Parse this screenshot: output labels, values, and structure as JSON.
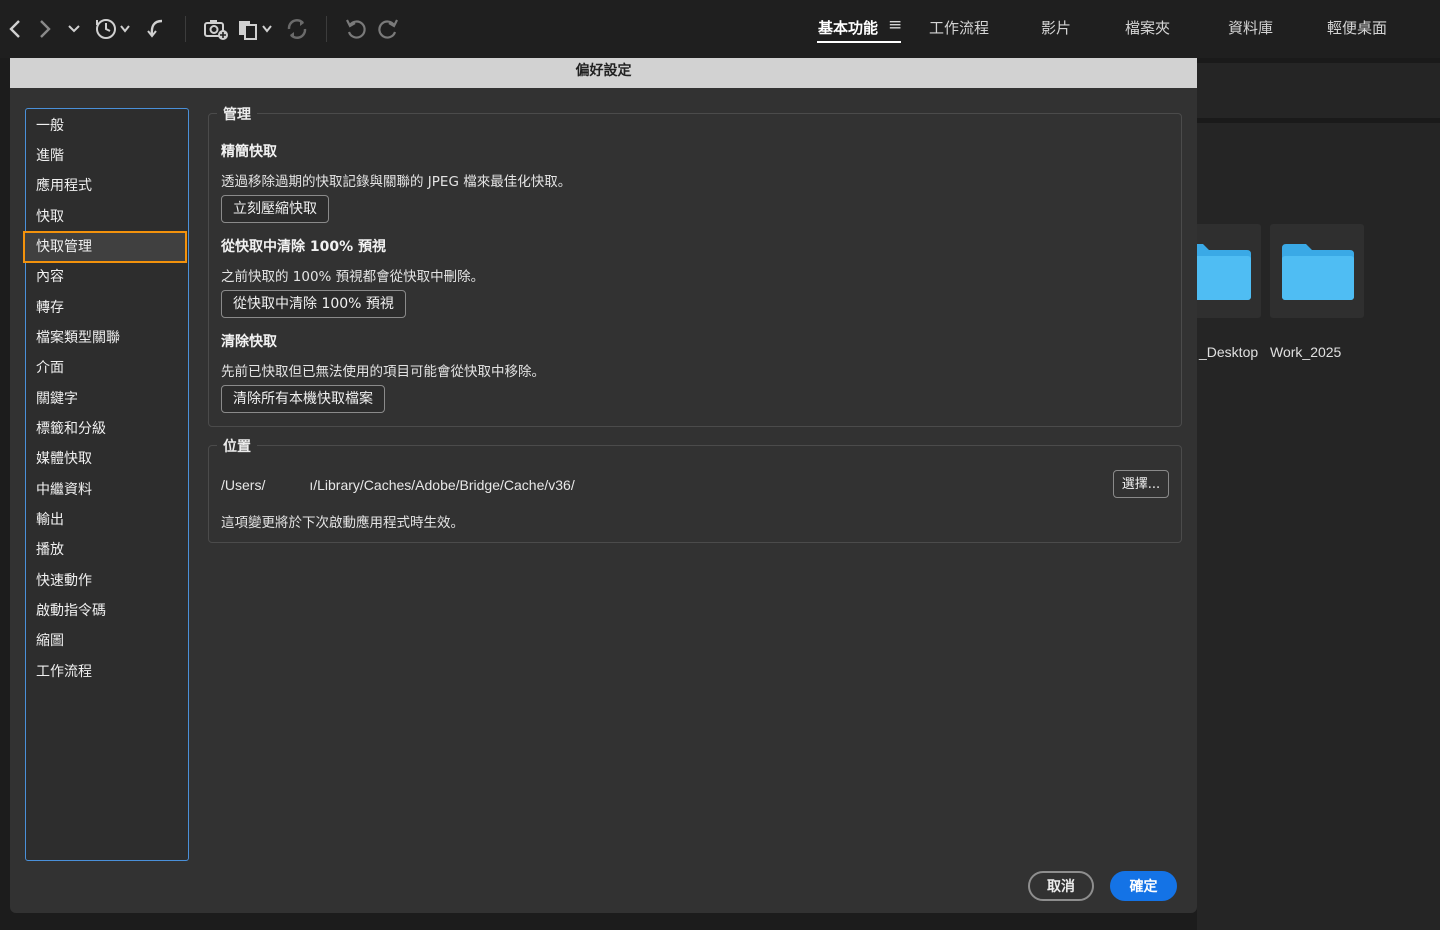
{
  "toolbar": {
    "icons": [
      "back-icon",
      "forward-icon",
      "recent-dropdown-icon",
      "history-icon",
      "return-icon",
      "camera-import-icon",
      "copy-stack-icon",
      "sync-icon",
      "rotate-left-icon",
      "rotate-right-icon"
    ],
    "workspaces": [
      {
        "label": "基本功能",
        "active": true
      },
      {
        "label": "工作流程",
        "active": false
      },
      {
        "label": "影片",
        "active": false
      },
      {
        "label": "檔案夾",
        "active": false
      },
      {
        "label": "資料庫",
        "active": false
      },
      {
        "label": "輕便桌面",
        "active": false
      }
    ],
    "menu_icon": "≡"
  },
  "background": {
    "folders": [
      {
        "label": "_Desktop"
      },
      {
        "label": "Work_2025"
      }
    ],
    "folder_color": "#3aa9e6"
  },
  "dialog": {
    "title": "偏好設定",
    "sidebar": {
      "items": [
        "一般",
        "進階",
        "應用程式",
        "快取",
        "快取管理",
        "內容",
        "轉存",
        "檔案類型關聯",
        "介面",
        "關鍵字",
        "標籤和分級",
        "媒體快取",
        "中繼資料",
        "輸出",
        "播放",
        "快速動作",
        "啟動指令碼",
        "縮圖",
        "工作流程"
      ],
      "selected": "快取管理",
      "selected_color": "#f3920c"
    },
    "manage": {
      "legend": "管理",
      "compact_title": "精簡快取",
      "compact_desc": "透過移除過期的快取記錄與關聯的 JPEG 檔來最佳化快取。",
      "compact_button": "立刻壓縮快取",
      "purge100_title": "從快取中清除 100% 預視",
      "purge100_desc": "之前快取的 100% 預視都會從快取中刪除。",
      "purge100_button": "從快取中清除 100% 預視",
      "purge_title": "清除快取",
      "purge_desc": "先前已快取但已無法使用的項目可能會從快取中移除。",
      "purge_button": "清除所有本機快取檔案"
    },
    "location": {
      "legend": "位置",
      "path_prefix": "/Users/",
      "path_suffix": "ı/Library/Caches/Adobe/Bridge/Cache/v36/",
      "choose_button": "選擇...",
      "note": "這項變更將於下次啟動應用程式時生效。"
    },
    "cancel_button": "取消",
    "ok_button": "確定",
    "accent": "#1473e6"
  }
}
